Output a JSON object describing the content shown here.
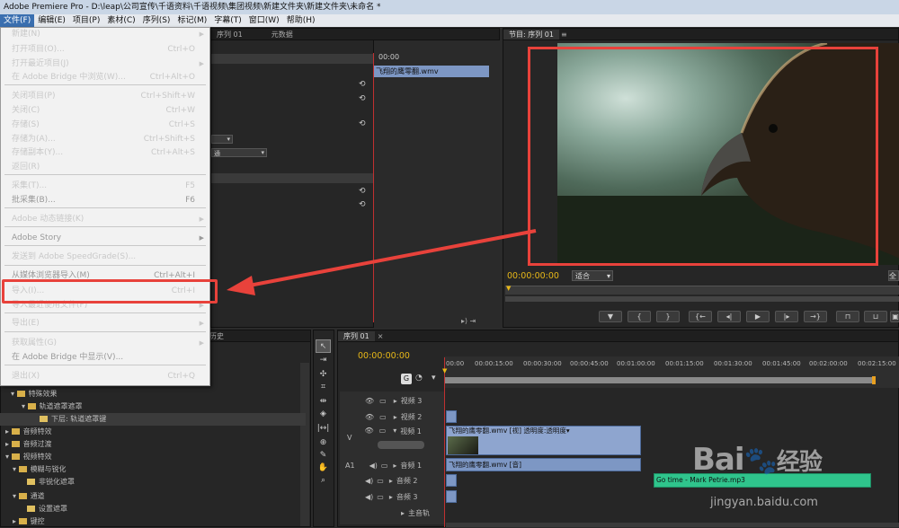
{
  "window": {
    "title": "Adobe Premiere Pro - D:\\leap\\公司宣传\\千语资料\\千语视频\\集团视频\\新建文件夹\\新建文件夹\\未命名 *"
  },
  "menubar": [
    "文件(F)",
    "编辑(E)",
    "项目(P)",
    "素材(C)",
    "序列(S)",
    "标记(M)",
    "字幕(T)",
    "窗口(W)",
    "帮助(H)"
  ],
  "file_menu": [
    {
      "label": "新建(N)",
      "shortcut": "",
      "submenu": true,
      "disabled": false
    },
    {
      "label": "打开项目(O)...",
      "shortcut": "Ctrl+O",
      "submenu": false,
      "disabled": false
    },
    {
      "label": "打开最近项目(J)",
      "shortcut": "",
      "submenu": true,
      "disabled": false
    },
    {
      "label": "在 Adobe Bridge 中浏览(W)...",
      "shortcut": "Ctrl+Alt+O",
      "submenu": false,
      "disabled": false
    },
    {
      "label": "关闭项目(P)",
      "shortcut": "Ctrl+Shift+W",
      "submenu": false,
      "disabled": false
    },
    {
      "label": "关闭(C)",
      "shortcut": "Ctrl+W",
      "submenu": false,
      "disabled": false
    },
    {
      "label": "存储(S)",
      "shortcut": "Ctrl+S",
      "submenu": false,
      "disabled": false
    },
    {
      "label": "存储为(A)...",
      "shortcut": "Ctrl+Shift+S",
      "submenu": false,
      "disabled": false
    },
    {
      "label": "存储副本(Y)...",
      "shortcut": "Ctrl+Alt+S",
      "submenu": false,
      "disabled": false
    },
    {
      "label": "返回(R)",
      "shortcut": "",
      "submenu": false,
      "disabled": false
    },
    {
      "label": "采集(T)...",
      "shortcut": "F5",
      "submenu": false,
      "disabled": false
    },
    {
      "label": "批采集(B)...",
      "shortcut": "F6",
      "submenu": false,
      "disabled": true
    },
    {
      "label": "Adobe 动态链接(K)",
      "shortcut": "",
      "submenu": true,
      "disabled": false
    },
    {
      "label": "Adobe Story",
      "shortcut": "",
      "submenu": true,
      "disabled": true
    },
    {
      "label": "发送到 Adobe SpeedGrade(S)...",
      "shortcut": "",
      "submenu": false,
      "disabled": false
    },
    {
      "label": "从媒体浏览器导入(M)",
      "shortcut": "Ctrl+Alt+I",
      "submenu": false,
      "disabled": true
    },
    {
      "label": "导入(I)...",
      "shortcut": "Ctrl+I",
      "submenu": false,
      "disabled": false
    },
    {
      "label": "导入最近使用文件(F)",
      "shortcut": "",
      "submenu": true,
      "disabled": false
    },
    {
      "label": "导出(E)",
      "shortcut": "",
      "submenu": true,
      "disabled": false
    },
    {
      "label": "获取属性(G)",
      "shortcut": "",
      "submenu": true,
      "disabled": false
    },
    {
      "label": "在 Adobe Bridge 中显示(V)...",
      "shortcut": "",
      "submenu": false,
      "disabled": true
    },
    {
      "label": "退出(X)",
      "shortcut": "Ctrl+Q",
      "submenu": false,
      "disabled": false
    }
  ],
  "source_panel": {
    "tab1": "序列 01",
    "tab2": "元数据",
    "ruler_time": "00:00",
    "clip_name": "飞翔的鹰零翻.wmv",
    "dropdown_text": "通"
  },
  "program_monitor": {
    "tab": "节目: 序列 01",
    "timecode": "00:00:00:00",
    "fit": "适合",
    "right_btn": "全"
  },
  "effects_panel": {
    "tab": "历史",
    "items": [
      {
        "label": "特殊效果",
        "level": 1
      },
      {
        "label": "轨道遮罩遮罩",
        "level": 2
      },
      {
        "label": "下层: 轨道遮罩键",
        "level": 3
      },
      {
        "label": "音频特效",
        "level": 0
      },
      {
        "label": "音频过渡",
        "level": 0
      },
      {
        "label": "视频特效",
        "level": 0
      },
      {
        "label": "模糊与锐化",
        "level": 1
      },
      {
        "label": "非锐化遮罩",
        "level": 2
      },
      {
        "label": "通道",
        "level": 1
      },
      {
        "label": "设置遮罩",
        "level": 2
      },
      {
        "label": "键控",
        "level": 1
      }
    ]
  },
  "timeline": {
    "tab": "序列 01",
    "timecode": "00:00:00:00",
    "ruler": [
      "00:00",
      "00:00:15:00",
      "00:00:30:00",
      "00:00:45:00",
      "00:01:00:00",
      "00:01:15:00",
      "00:01:30:00",
      "00:01:45:00",
      "00:02:00:00",
      "00:02:15:00"
    ],
    "tracks": [
      {
        "side": "",
        "name": "视频 3"
      },
      {
        "side": "",
        "name": "视频 2"
      },
      {
        "side": "V",
        "name": "视频 1"
      },
      {
        "side": "A1",
        "name": "音频 1"
      },
      {
        "side": "",
        "name": "音频 2"
      },
      {
        "side": "",
        "name": "音频 3"
      },
      {
        "side": "",
        "name": "主音轨"
      }
    ],
    "video_clip": "飞翔的鹰零翻.wmv [视] 透明度:透明度▾",
    "audio_clip": "飞翔的鹰零翻.wmv [音]",
    "green_clip": "Go time - Mark Petrie.mp3"
  },
  "watermark": {
    "url": "jingyan.baidu.com",
    "brand": "Bai",
    "brand2": "经验"
  },
  "colors": {
    "highlight": "#e8423b",
    "timecode": "#e8b818",
    "clip": "#7d97c4"
  }
}
